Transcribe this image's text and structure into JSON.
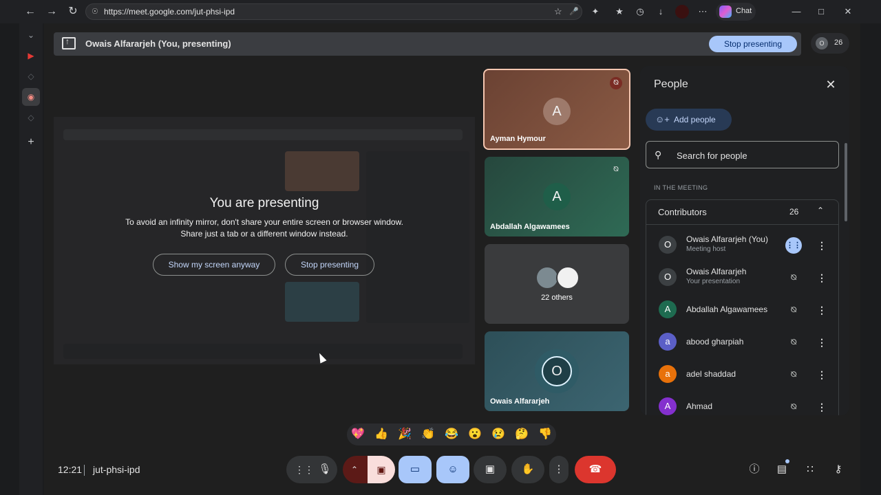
{
  "browser": {
    "url": "https://meet.google.com/jut-phsi-ipd",
    "chat_label": "Chat",
    "icons": [
      "back-icon",
      "forward-icon",
      "reload-icon",
      "lock-icon",
      "star-icon",
      "mic-icon",
      "extensions-icon",
      "favorites-icon",
      "history-icon",
      "download-icon",
      "profile-icon",
      "more-icon"
    ],
    "window_controls": [
      "minimize",
      "maximize",
      "close"
    ]
  },
  "presenting_bar": {
    "title": "Owais Alfararjeh (You, presenting)",
    "stop_label": "Stop presenting",
    "participant_count": "26",
    "avatar_letter": "O"
  },
  "presenting_notice": {
    "heading": "You are presenting",
    "line1": "To avoid an infinity mirror, don't share your entire screen or browser window.",
    "line2": "Share just a tab or a different window instead.",
    "show_anyway": "Show my screen anyway",
    "stop": "Stop presenting"
  },
  "tiles": [
    {
      "letter": "A",
      "name": "Ayman Hymour",
      "muted": true,
      "bg": "#6b4233",
      "active": true
    },
    {
      "letter": "A",
      "name": "Abdallah Algawamees",
      "muted": true,
      "bg": "#2c5b49"
    },
    {
      "name": "",
      "others_label": "22 others",
      "bg": "#3a3b3d"
    },
    {
      "letter": "O",
      "name": "Owais Alfararjeh",
      "bg": "#2d4f58"
    }
  ],
  "people_panel": {
    "title": "People",
    "add_label": "Add people",
    "search_placeholder": "Search for people",
    "section": "IN THE MEETING",
    "contributors_label": "Contributors",
    "contributors_count": "26",
    "rows": [
      {
        "letter": "O",
        "name": "Owais Alfararjeh (You)",
        "sub": "Meeting host",
        "color": "#3c4043",
        "speaking": true
      },
      {
        "letter": "O",
        "name": "Owais Alfararjeh",
        "sub": "Your presentation",
        "color": "#3c4043"
      },
      {
        "letter": "A",
        "name": "Abdallah Algawamees",
        "sub": "",
        "color": "#1e6b50"
      },
      {
        "letter": "a",
        "name": "abood gharpiah",
        "sub": "",
        "color": "#5b5fc7"
      },
      {
        "letter": "a",
        "name": "adel shaddad",
        "sub": "",
        "color": "#e8710a"
      },
      {
        "letter": "A",
        "name": "Ahmad",
        "sub": "",
        "color": "#8430ce"
      }
    ]
  },
  "reactions": [
    "💖",
    "👍",
    "🎉",
    "👏",
    "😂",
    "😮",
    "😢",
    "🤔",
    "👎"
  ],
  "bottom": {
    "time": "12:21",
    "meeting_code": "jut-phsi-ipd"
  },
  "colors": {
    "accent": "#a8c7fa",
    "hangup": "#dc362e",
    "cam_off": "#f9dedc"
  }
}
